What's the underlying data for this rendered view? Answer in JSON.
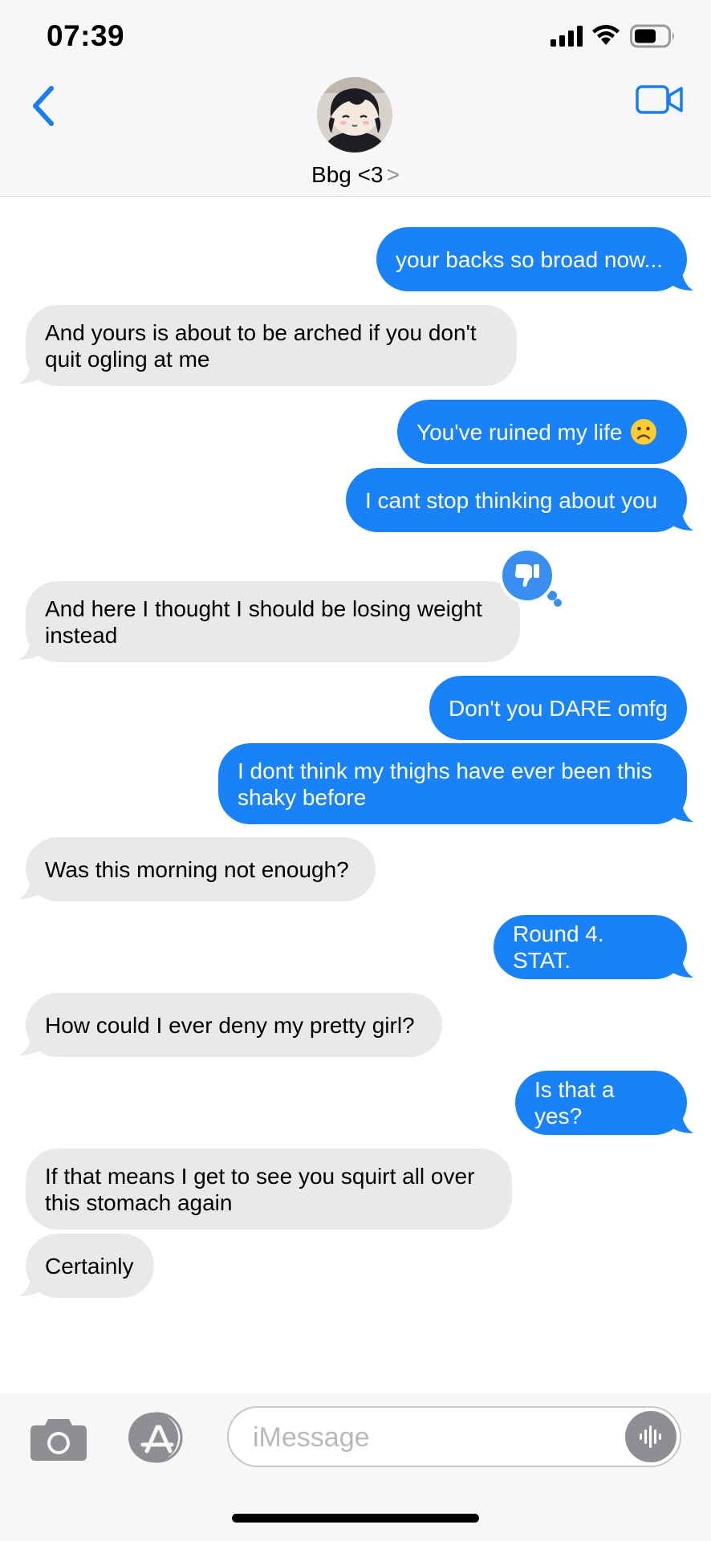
{
  "status_bar": {
    "time": "07:39",
    "battery_level": 0.6
  },
  "header": {
    "contact_name": "Bbg <3",
    "name_chevron": ">",
    "icons": [
      "back-chevron-icon",
      "video-camera-icon"
    ]
  },
  "messages": [
    {
      "sender": "me",
      "text": "your backs so broad now..."
    },
    {
      "sender": "them",
      "text": "And yours is about to be arched if you don't\nquit ogling at me"
    },
    {
      "sender": "me",
      "text": "You've ruined my life"
    },
    {
      "sender": "me",
      "text": "I cant stop thinking about you"
    },
    {
      "sender": "them",
      "text": "And here I thought I should be losing weight\ninstead",
      "reaction": "thumbs-down-icon"
    },
    {
      "sender": "me",
      "text": "Don't you DARE omfg"
    },
    {
      "sender": "me",
      "text": "I dont think my thighs have ever been this\nshaky before"
    },
    {
      "sender": "them",
      "text": "Was this morning not enough?"
    },
    {
      "sender": "me",
      "text": "Round 4. STAT."
    },
    {
      "sender": "them",
      "text": "How could I ever deny my pretty girl?"
    },
    {
      "sender": "me",
      "text": "Is that a yes?"
    },
    {
      "sender": "them",
      "text": "If that means I get to see you squirt all over\nthis stomach again"
    },
    {
      "sender": "them",
      "text": "Certainly"
    }
  ],
  "composer": {
    "placeholder": "iMessage",
    "icons": [
      "camera-icon",
      "app-store-icon",
      "audio-waveform-icon"
    ]
  },
  "colors": {
    "sent_bubble": "#1a82f8",
    "received_bubble": "#e9e9eb",
    "accent": "#1a7cf5"
  }
}
